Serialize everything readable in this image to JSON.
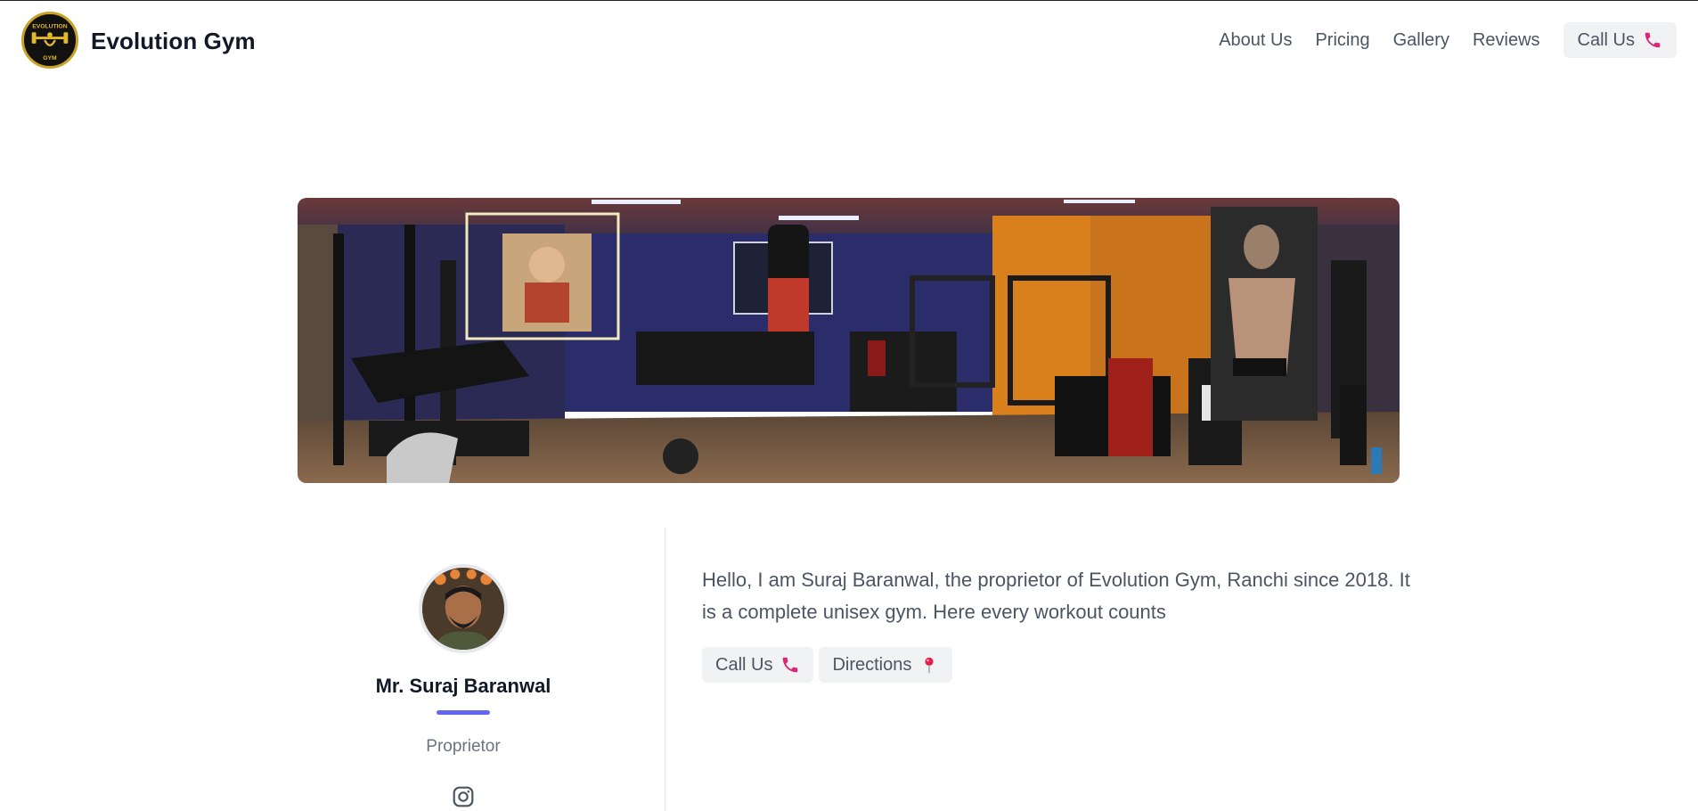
{
  "header": {
    "brand": "Evolution Gym",
    "logo_top": "EVOLUTION",
    "logo_bottom": "GYM",
    "nav": [
      "About Us",
      "Pricing",
      "Gallery",
      "Reviews"
    ],
    "call_label": "Call Us"
  },
  "hero": {
    "image": "gym-interior-photo"
  },
  "profile": {
    "name": "Mr. Suraj Baranwal",
    "role": "Proprietor",
    "social_icon": "instagram-icon",
    "bio": "Hello, I am Suraj Baranwal, the proprietor of Evolution Gym, Ranchi since 2018. It is a complete unisex gym. Here every workout counts",
    "call_label": "Call Us",
    "directions_label": "Directions"
  },
  "colors": {
    "accent": "#6366f1",
    "icon_pink": "#db2777",
    "button_bg": "#f1f2f4",
    "text": "#4b5563",
    "heading": "#111827"
  }
}
